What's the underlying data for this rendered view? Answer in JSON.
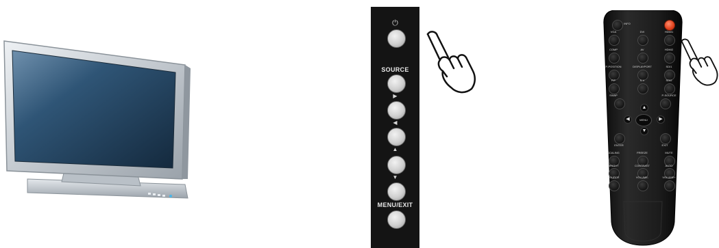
{
  "control_panel": {
    "power_symbol": "⏻",
    "source_label": "SOURCE",
    "arrow_right": "▶",
    "arrow_left": "◀",
    "arrow_up": "▲",
    "arrow_down": "▼",
    "menu_exit_label": "MENU/EXIT"
  },
  "remote": {
    "buttons": [
      {
        "label": "INFO"
      },
      {
        "label": "VGA"
      },
      {
        "label": "DVI"
      },
      {
        "label": "HDMI1"
      },
      {
        "label": "COMP"
      },
      {
        "label": "AV"
      },
      {
        "label": "HDMI2"
      },
      {
        "label": "P-POSITION"
      },
      {
        "label": "DISPLAYPORT"
      },
      {
        "label": "SDI1"
      },
      {
        "label": "PIP"
      },
      {
        "label": "S-V"
      },
      {
        "label": "SDI2"
      },
      {
        "label": "SWAP"
      },
      {
        "label": "P-SOURCE"
      },
      {
        "label": "ENTER"
      },
      {
        "label": "EXIT"
      },
      {
        "label": "SCALING"
      },
      {
        "label": "FREEZE"
      },
      {
        "label": "MUTE"
      },
      {
        "label": "BRIGHT"
      },
      {
        "label": "CONTRAST"
      },
      {
        "label": "AUTO"
      },
      {
        "label": "SOURCE"
      },
      {
        "label": "VOLUME-"
      },
      {
        "label": "VOLUME+"
      }
    ],
    "menu_label": "MENU",
    "arrow_up": "▲",
    "arrow_down": "▼",
    "arrow_left": "◀",
    "arrow_right": "▶"
  },
  "colors": {
    "panel": "#141414",
    "remote_body": "#1a1a1a",
    "power_button": "#e0401c",
    "tv_frame": "#c7cdd2",
    "tv_screen": "#2a4a66"
  }
}
